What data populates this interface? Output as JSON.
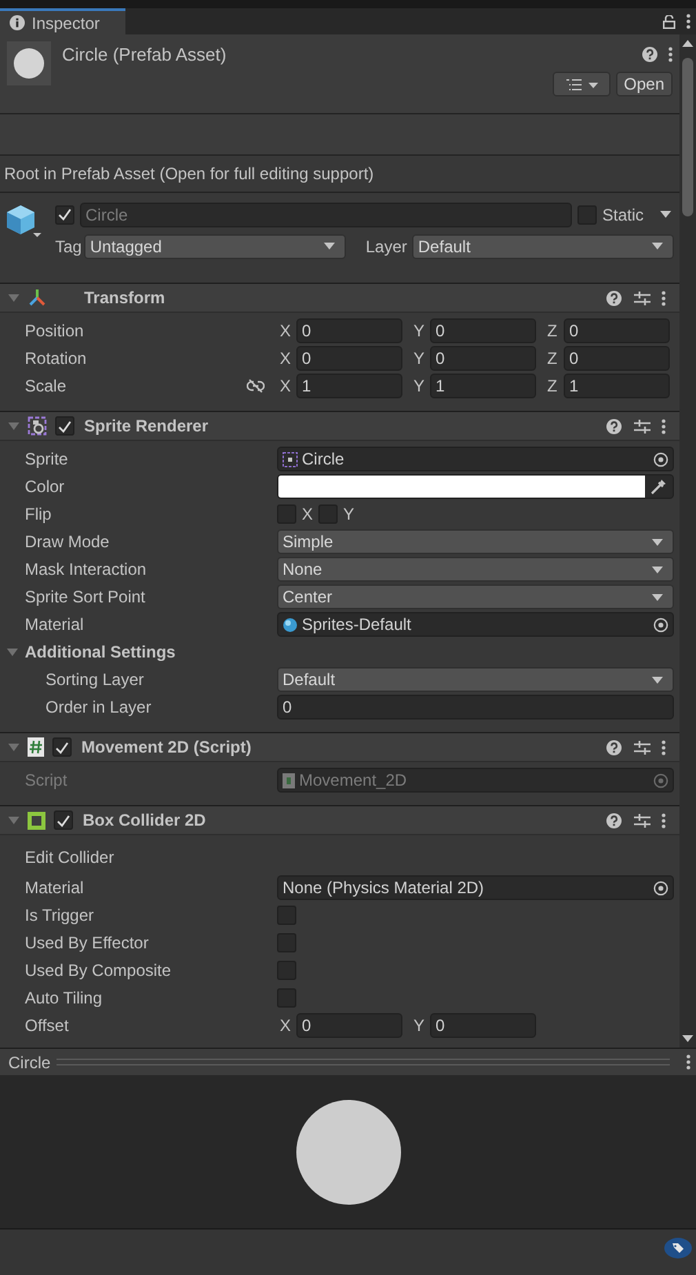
{
  "tab": {
    "label": "Inspector",
    "selected": true
  },
  "header": {
    "title": "Circle (Prefab Asset)",
    "open_button": "Open"
  },
  "info_text": "Root in Prefab Asset (Open for full editing support)",
  "game_object": {
    "active": true,
    "name": "Circle",
    "name_disabled": true,
    "static": false,
    "static_label": "Static",
    "tag_label": "Tag",
    "tag": "Untagged",
    "layer_label": "Layer",
    "layer": "Default"
  },
  "components": [
    {
      "kind": "transform",
      "title": "Transform",
      "expanded": true,
      "rows": [
        {
          "kind": "vector",
          "label": "Position",
          "fields": [
            {
              "axis": "X",
              "value": "0"
            },
            {
              "axis": "Y",
              "value": "0"
            },
            {
              "axis": "Z",
              "value": "0"
            }
          ]
        },
        {
          "kind": "vector",
          "label": "Rotation",
          "fields": [
            {
              "axis": "X",
              "value": "0"
            },
            {
              "axis": "Y",
              "value": "0"
            },
            {
              "axis": "Z",
              "value": "0"
            }
          ]
        },
        {
          "kind": "vector",
          "label": "Scale",
          "constrained": false,
          "fields": [
            {
              "axis": "X",
              "value": "1"
            },
            {
              "axis": "Y",
              "value": "1"
            },
            {
              "axis": "Z",
              "value": "1"
            }
          ]
        }
      ]
    },
    {
      "kind": "sprite_renderer",
      "title": "Sprite Renderer",
      "enabled": true,
      "expanded": true,
      "rows": [
        {
          "kind": "sprite_object",
          "label": "Sprite",
          "value": "Circle"
        },
        {
          "kind": "color",
          "label": "Color",
          "color": "#ffffff"
        },
        {
          "kind": "flip",
          "label": "Flip",
          "toggles": [
            {
              "label": "X",
              "checked": false
            },
            {
              "label": "Y",
              "checked": false
            }
          ]
        },
        {
          "kind": "dropdown",
          "label": "Draw Mode",
          "value": "Simple"
        },
        {
          "kind": "dropdown",
          "label": "Mask Interaction",
          "value": "None"
        },
        {
          "kind": "dropdown",
          "label": "Sprite Sort Point",
          "value": "Center"
        },
        {
          "kind": "material_object",
          "label": "Material",
          "value": "Sprites-Default"
        },
        {
          "kind": "foldout",
          "label": "Additional Settings",
          "expanded": true,
          "children": [
            {
              "kind": "dropdown",
              "label": "Sorting Layer",
              "value": "Default"
            },
            {
              "kind": "number",
              "label": "Order in Layer",
              "value": "0"
            }
          ]
        }
      ]
    },
    {
      "kind": "script",
      "title": "Movement 2D (Script)",
      "enabled": true,
      "expanded": true,
      "rows": [
        {
          "kind": "script_object",
          "label": "Script",
          "value": "Movement_2D",
          "disabled": true
        }
      ]
    },
    {
      "kind": "box_collider",
      "title": "Box Collider 2D",
      "enabled": true,
      "expanded": true,
      "rows": [
        {
          "kind": "label",
          "label": "Edit Collider"
        },
        {
          "kind": "object",
          "label": "Material",
          "value": "None (Physics Material 2D)"
        },
        {
          "kind": "toggle",
          "label": "Is Trigger",
          "checked": false
        },
        {
          "kind": "toggle",
          "label": "Used By Effector",
          "checked": false
        },
        {
          "kind": "toggle",
          "label": "Used By Composite",
          "checked": false
        },
        {
          "kind": "toggle",
          "label": "Auto Tiling",
          "checked": false
        },
        {
          "kind": "vector",
          "label": "Offset",
          "fields": [
            {
              "axis": "X",
              "value": "0"
            },
            {
              "axis": "Y",
              "value": "0"
            }
          ]
        }
      ]
    }
  ],
  "preview": {
    "title": "Circle"
  }
}
